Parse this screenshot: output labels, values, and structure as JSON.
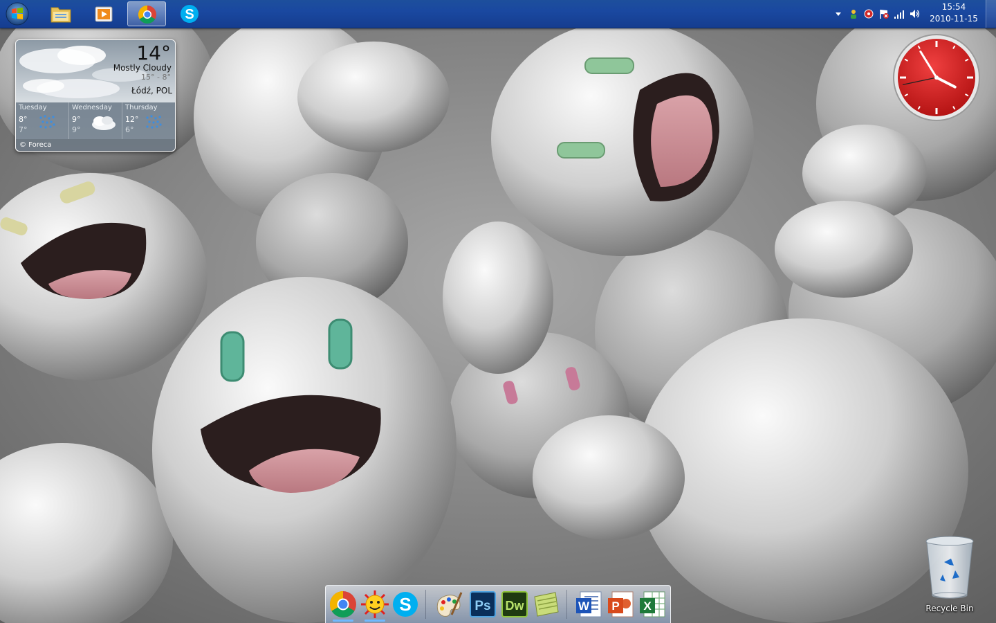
{
  "taskbar": {
    "start_button": "Start",
    "pinned": [
      {
        "name": "file-explorer",
        "active": false
      },
      {
        "name": "media-player",
        "active": false
      },
      {
        "name": "chrome",
        "active": true
      },
      {
        "name": "skype",
        "active": false
      }
    ],
    "clock": {
      "time": "15:54",
      "date": "2010-11-15"
    }
  },
  "weather": {
    "temperature": "14°",
    "condition": "Mostly Cloudy",
    "range": "15° - 8°",
    "location": "Łódź, POL",
    "forecast": [
      {
        "day": "Tuesday",
        "high": "8°",
        "low": "7°",
        "icon": "rain-icon"
      },
      {
        "day": "Wednesday",
        "high": "9°",
        "low": "9°",
        "icon": "cloud-icon"
      },
      {
        "day": "Thursday",
        "high": "12°",
        "low": "6°",
        "icon": "rain-icon"
      }
    ],
    "credit": "© Foreca"
  },
  "clock_gadget": {
    "hour": 15,
    "minute": 54,
    "second": 43,
    "face_color": "#d42020"
  },
  "desktop": {
    "recycle_bin_label": "Recycle Bin"
  },
  "dock": {
    "items": [
      "chrome",
      "weather-app",
      "skype",
      "paint",
      "photoshop",
      "dreamweaver",
      "notes",
      "word",
      "powerpoint",
      "excel"
    ]
  }
}
